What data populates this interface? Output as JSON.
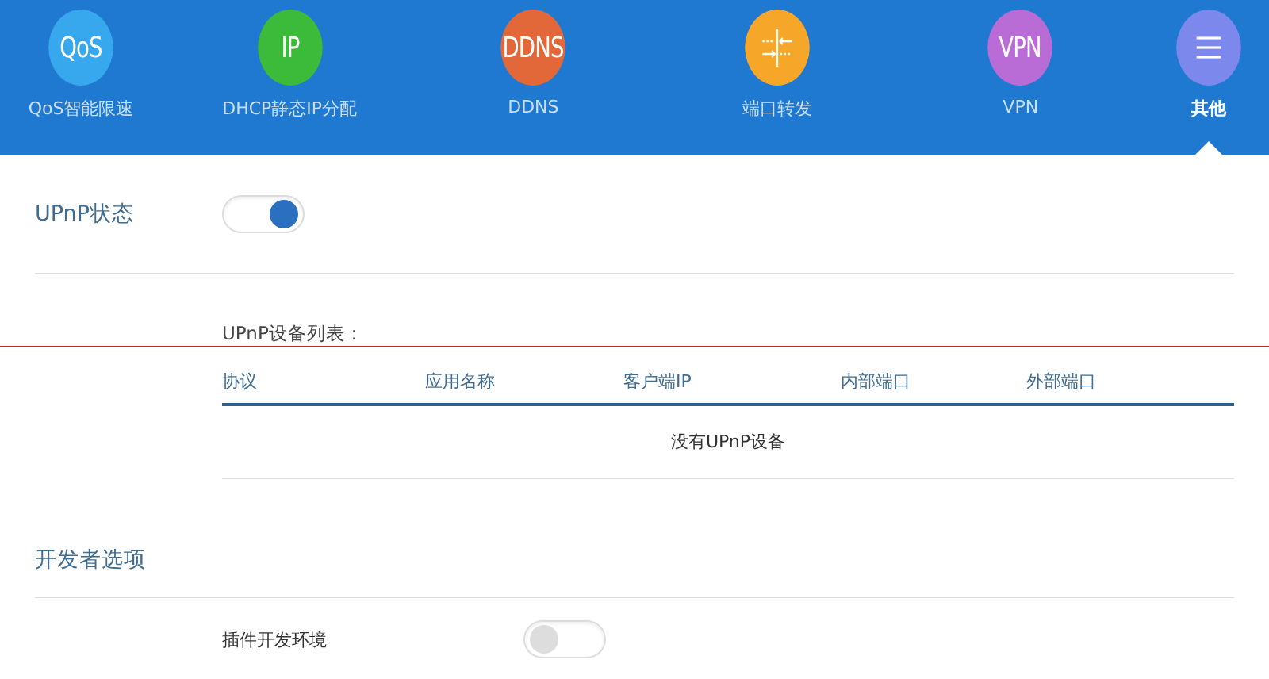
{
  "nav": [
    {
      "kind": "text",
      "icon_text": "QoS",
      "label": "QoS智能限速",
      "color": "#38a8ee",
      "selected": false
    },
    {
      "kind": "text",
      "icon_text": "IP",
      "label": "DHCP静态IP分配",
      "color": "#3cba3a",
      "selected": false
    },
    {
      "kind": "text",
      "icon_text": "DDNS",
      "label": "DDNS",
      "color": "#e2683a",
      "selected": false
    },
    {
      "kind": "arrows",
      "label": "端口转发",
      "color": "#f6a628",
      "selected": false
    },
    {
      "kind": "text",
      "icon_text": "VPN",
      "label": "VPN",
      "color": "#b96bd6",
      "selected": false
    },
    {
      "kind": "menu",
      "label": "其他",
      "color": "#7d88ec",
      "selected": true
    }
  ],
  "upnp": {
    "label": "UPnP状态",
    "on": true
  },
  "device_list": {
    "title": "UPnP设备列表：",
    "columns": [
      "协议",
      "应用名称",
      "客户端IP",
      "内部端口",
      "外部端口"
    ],
    "empty_text": "没有UPnP设备"
  },
  "developer": {
    "title": "开发者选项",
    "options": [
      {
        "label": "插件开发环境",
        "on": false
      }
    ]
  }
}
